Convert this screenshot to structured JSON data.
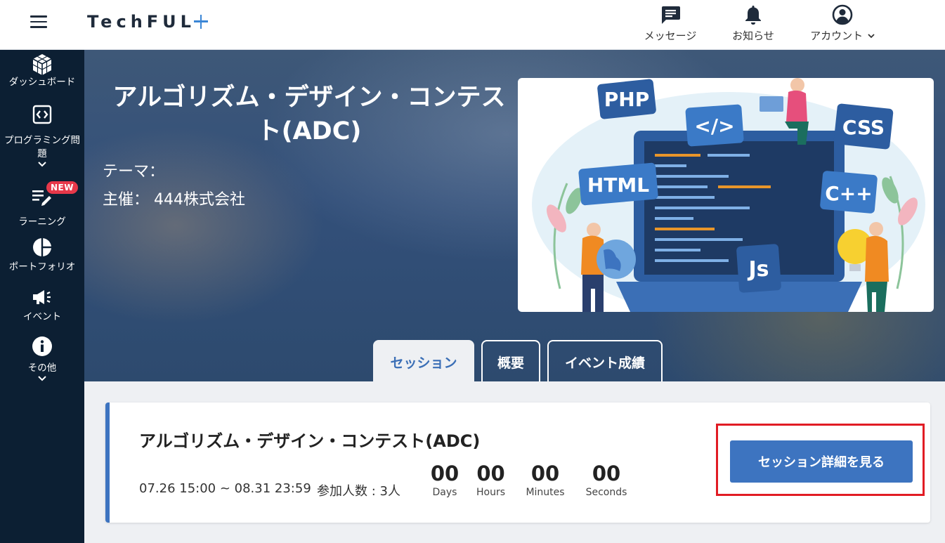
{
  "header": {
    "logo": "TechFUL",
    "actions": [
      {
        "label": "メッセージ",
        "icon": "message-icon"
      },
      {
        "label": "お知らせ",
        "icon": "bell-icon"
      },
      {
        "label": "アカウント",
        "icon": "account-icon"
      }
    ]
  },
  "sidebar": {
    "items": [
      {
        "label": "ダッシュボード",
        "icon": "dashboard-cube-icon"
      },
      {
        "label": "プログラミング問題",
        "icon": "code-icon"
      },
      {
        "label": "ラーニング",
        "icon": "learning-icon",
        "badge": "NEW"
      },
      {
        "label": "ポートフォリオ",
        "icon": "pie-chart-icon"
      },
      {
        "label": "イベント",
        "icon": "megaphone-icon"
      },
      {
        "label": "その他",
        "icon": "info-icon"
      }
    ]
  },
  "event": {
    "title": "アルゴリズム・デザイン・コンテスト(ADC)",
    "theme": "テーマ：",
    "organizer": "主催： 444株式会社",
    "image_labels": [
      "PHP",
      "</>",
      "CSS",
      "HTML",
      "C++",
      "Js"
    ]
  },
  "tabs": [
    {
      "label": "セッション",
      "active": true
    },
    {
      "label": "概要",
      "active": false
    },
    {
      "label": "イベント成績",
      "active": false
    }
  ],
  "session": {
    "title": "アルゴリズム・デザイン・コンテスト(ADC)",
    "date_range": "07.26 15:00 ~ 08.31 23:59",
    "participants": "参加人数 : 3人",
    "countdown": [
      {
        "value": "00",
        "unit": "Days"
      },
      {
        "value": "00",
        "unit": "Hours"
      },
      {
        "value": "00",
        "unit": "Minutes"
      },
      {
        "value": "00",
        "unit": "Seconds"
      }
    ],
    "detail_button": "セッション詳細を見る"
  },
  "colors": {
    "sidebar_bg": "#0c1f33",
    "accent": "#3d74c0",
    "highlight": "#e11c24",
    "badge": "#e7384a"
  }
}
